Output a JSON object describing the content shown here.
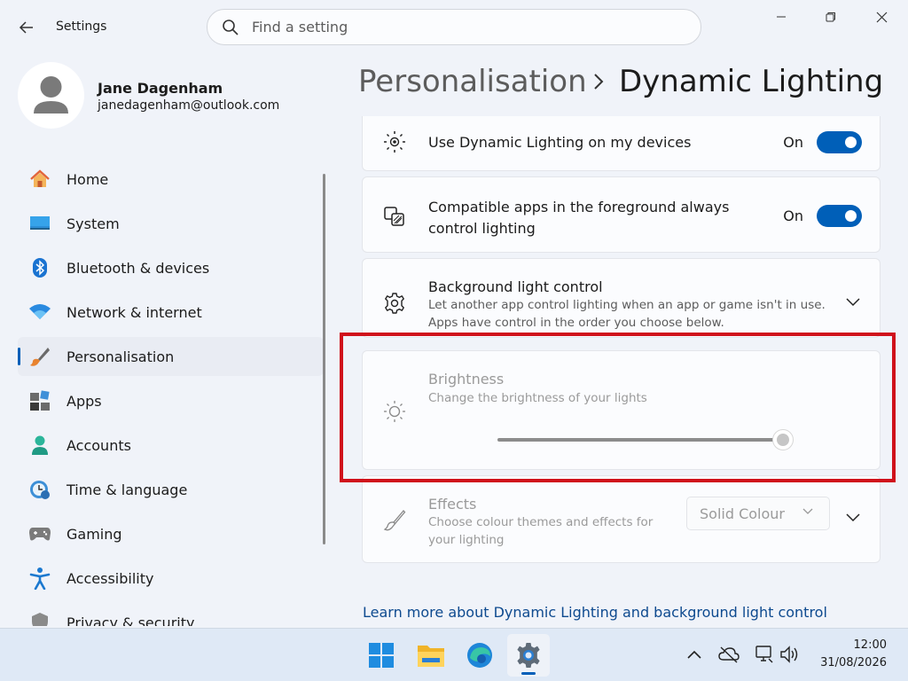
{
  "window": {
    "app_title": "Settings",
    "search_placeholder": "Find a setting"
  },
  "profile": {
    "name": "Jane Dagenham",
    "email": "janedagenham@outlook.com"
  },
  "sidebar": {
    "items": [
      {
        "label": "Home",
        "icon": "home-icon"
      },
      {
        "label": "System",
        "icon": "system-icon"
      },
      {
        "label": "Bluetooth & devices",
        "icon": "bluetooth-icon"
      },
      {
        "label": "Network & internet",
        "icon": "wifi-icon"
      },
      {
        "label": "Personalisation",
        "icon": "paintbrush-icon",
        "active": true
      },
      {
        "label": "Apps",
        "icon": "apps-icon"
      },
      {
        "label": "Accounts",
        "icon": "accounts-icon"
      },
      {
        "label": "Time & language",
        "icon": "time-language-icon"
      },
      {
        "label": "Gaming",
        "icon": "gamepad-icon"
      },
      {
        "label": "Accessibility",
        "icon": "accessibility-icon"
      },
      {
        "label": "Privacy & security",
        "icon": "shield-icon"
      }
    ]
  },
  "header": {
    "parent": "Personalisation",
    "separator": "›",
    "current": "Dynamic Lighting"
  },
  "settings": {
    "use_dynamic": {
      "title": "Use Dynamic Lighting on my devices",
      "state": "On"
    },
    "foreground_apps": {
      "title": "Compatible apps in the foreground always control lighting",
      "state": "On"
    },
    "background_control": {
      "title": "Background light control",
      "desc": "Let another app control lighting when an app or game isn't in use. Apps have control in the order you choose below."
    },
    "brightness": {
      "title": "Brightness",
      "desc": "Change the brightness of your lights",
      "value_percent": 100
    },
    "effects": {
      "title": "Effects",
      "desc": "Choose colour themes and effects for your lighting",
      "dropdown_value": "Solid Colour"
    }
  },
  "learn_more": "Learn more about Dynamic Lighting and background light control",
  "taskbar": {
    "apps": [
      "start-icon",
      "file-explorer-icon",
      "edge-icon",
      "settings-icon"
    ],
    "time": "12:00",
    "date": "31/08/2026"
  },
  "colors": {
    "accent": "#005fb8",
    "highlight": "#d0111b"
  }
}
